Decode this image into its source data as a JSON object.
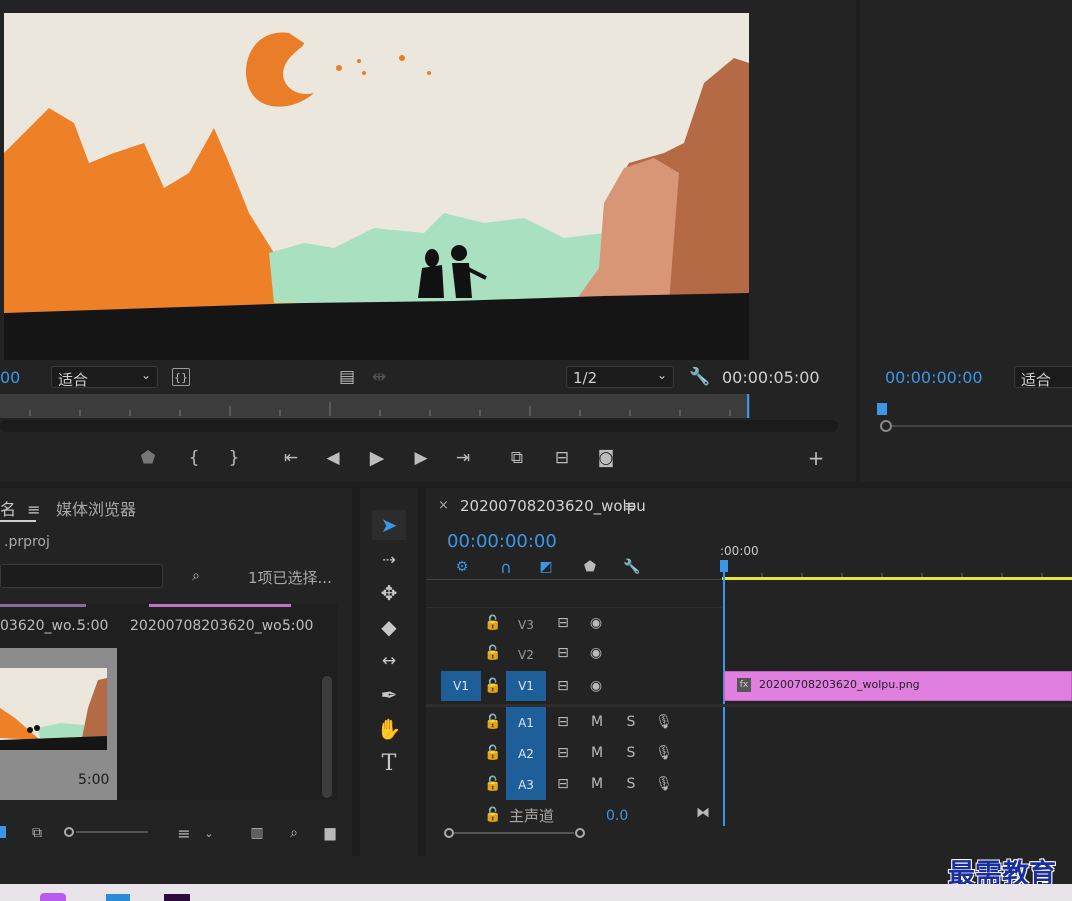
{
  "monitor": {
    "timecode_left": "00",
    "fit_label": "适合",
    "resolution": "1/2",
    "duration": "00:00:05:00"
  },
  "program": {
    "timecode": "00:00:00:00",
    "fit_label": "适合"
  },
  "project": {
    "tab_name": "名",
    "tab_media_browser": "媒体浏览器",
    "file_name": ".prproj",
    "selection_count": "1项已选择...",
    "items": [
      {
        "name": "03620_wo...",
        "duration": "5:00"
      },
      {
        "name": "20200708203620_wo...",
        "duration": "5:00"
      }
    ],
    "thumb_duration": "5:00"
  },
  "timeline": {
    "sequence_name": "20200708203620_wolpu",
    "timecode": "00:00:00:00",
    "ruler_start": ":00:00",
    "tracks_video": [
      {
        "label": "V3"
      },
      {
        "label": "V2"
      },
      {
        "label": "V1",
        "source": "V1"
      }
    ],
    "tracks_audio": [
      {
        "label": "A1",
        "m": "M",
        "s": "S"
      },
      {
        "label": "A2",
        "m": "M",
        "s": "S"
      },
      {
        "label": "A3",
        "m": "M",
        "s": "S"
      }
    ],
    "master_label": "主声道",
    "master_value": "0.0",
    "clip_name": "20200708203620_wolpu.png",
    "clip_fx": "fx",
    "clip_color": "#e07fe0"
  },
  "watermark": "最需教育",
  "colors": {
    "accent": "#3a97e8",
    "track_button": "#1f5f99",
    "playhead_yellow": "#e6e63a"
  }
}
